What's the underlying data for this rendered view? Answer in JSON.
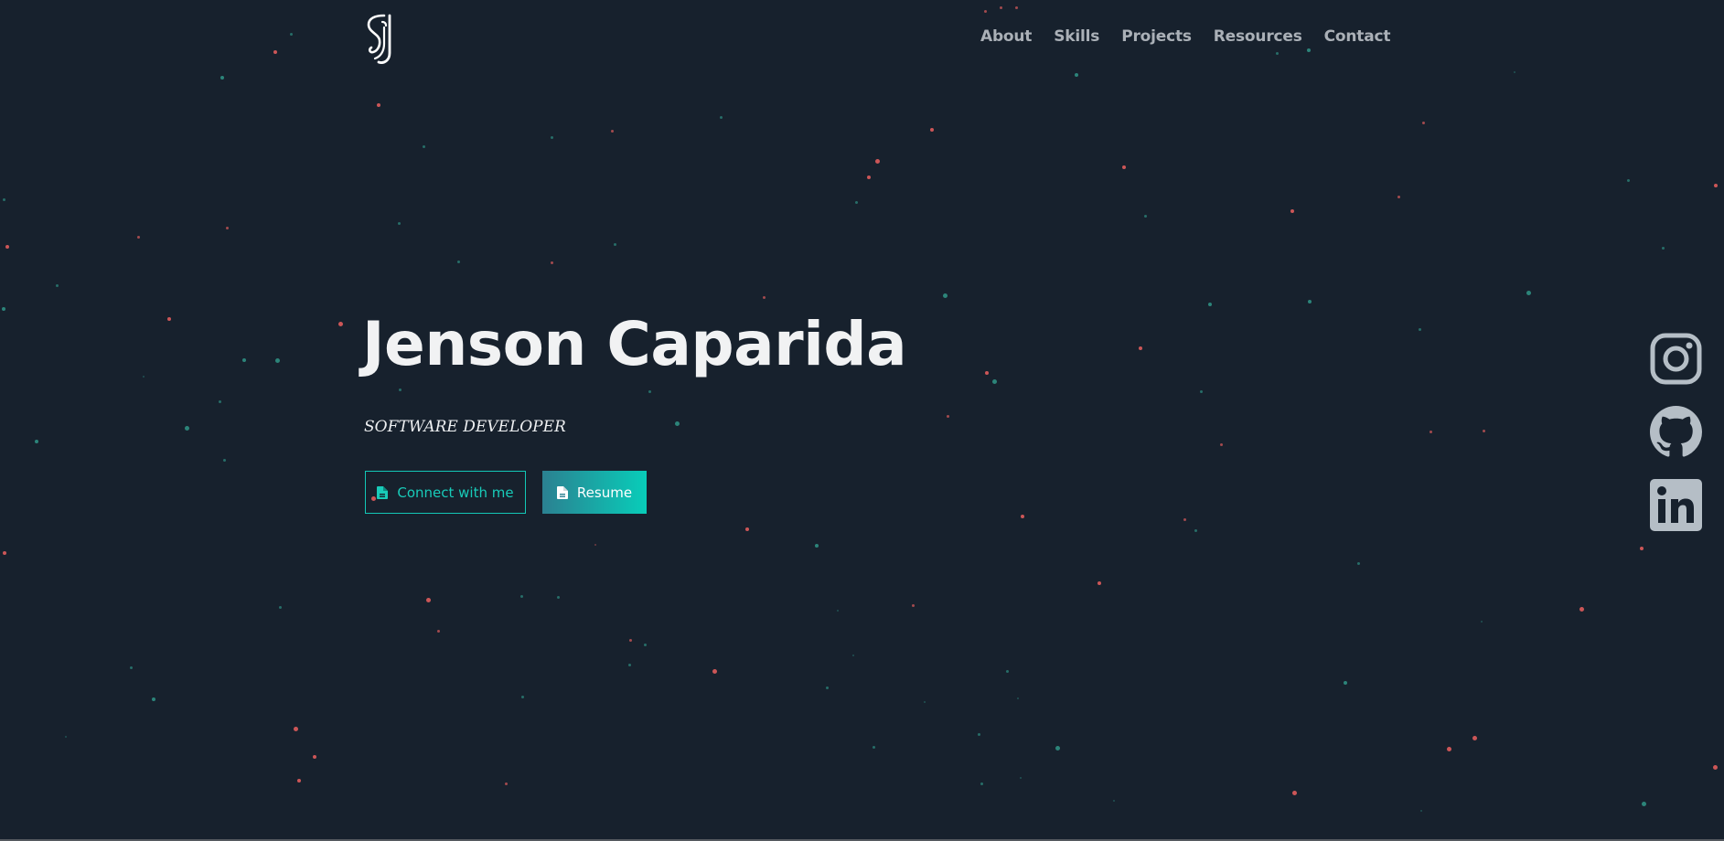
{
  "header": {
    "logo_icon": "sj-monogram-logo",
    "nav": [
      {
        "label": "About"
      },
      {
        "label": "Skills"
      },
      {
        "label": "Projects"
      },
      {
        "label": "Resources"
      },
      {
        "label": "Contact"
      }
    ]
  },
  "hero": {
    "name": "Jenson Caparida",
    "role": "SOFTWARE DEVELOPER",
    "connect_button": {
      "label": "Connect with me",
      "icon": "document-icon"
    },
    "resume_button": {
      "label": "Resume",
      "icon": "document-icon"
    }
  },
  "social": [
    {
      "icon": "instagram-icon"
    },
    {
      "icon": "github-icon"
    },
    {
      "icon": "linkedin-icon"
    }
  ],
  "colors": {
    "background": "#17212d",
    "accent": "#13c7b6",
    "particle_red": "#e05c5c",
    "particle_teal": "#2f8f82",
    "nav_text": "#aab0b7",
    "social_icon": "#b5bec6"
  }
}
